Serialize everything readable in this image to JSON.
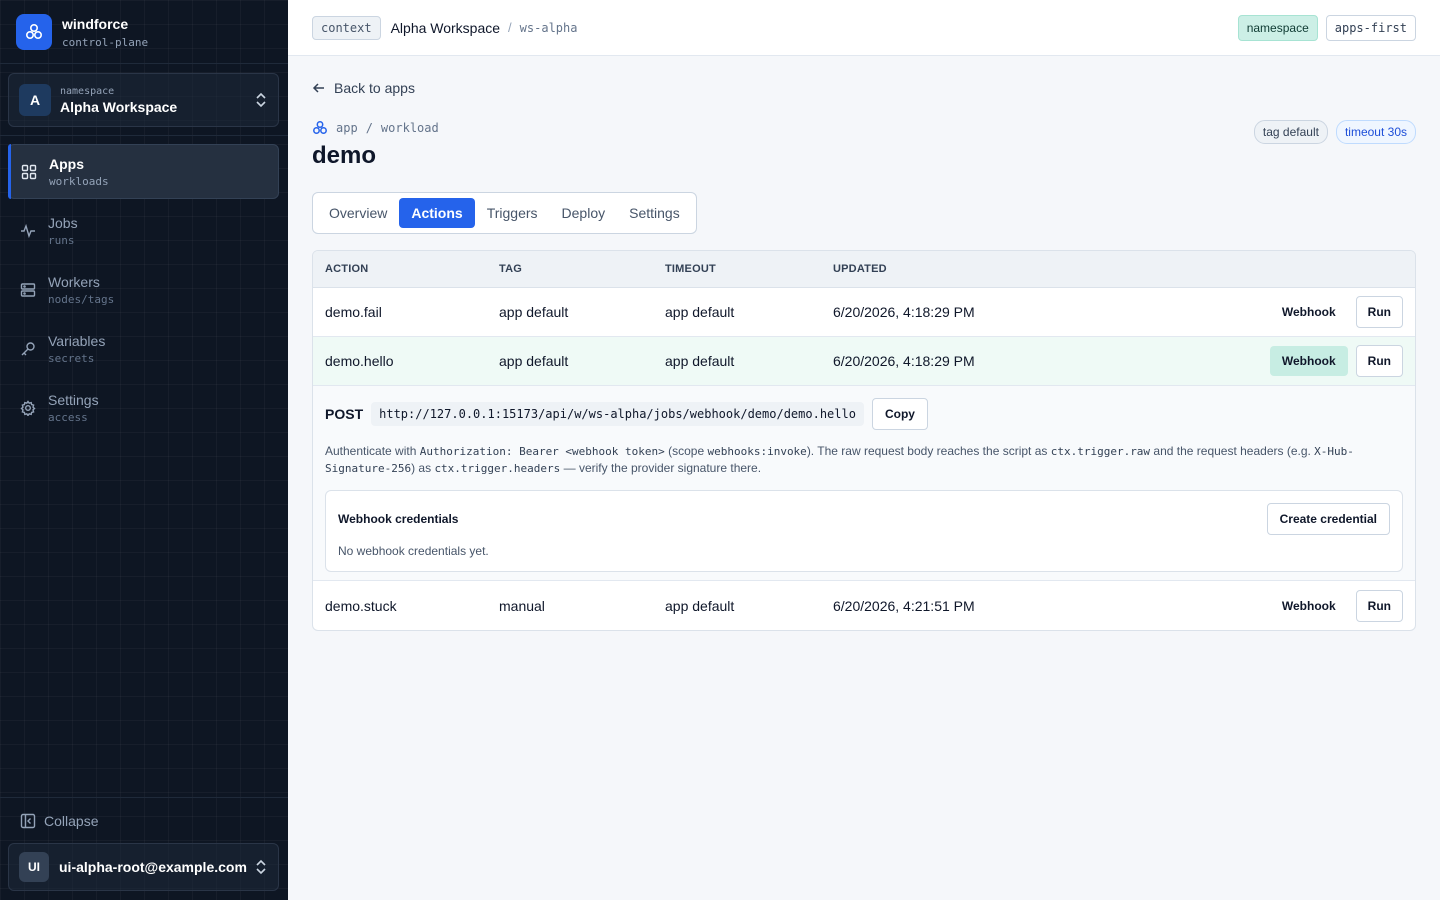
{
  "brand": {
    "name": "windforce",
    "sub": "control-plane"
  },
  "namespace": {
    "avatar": "A",
    "label": "namespace",
    "name": "Alpha Workspace"
  },
  "nav": [
    {
      "label": "Apps",
      "sub": "workloads",
      "icon": "grid-icon",
      "active": true
    },
    {
      "label": "Jobs",
      "sub": "runs",
      "icon": "activity-icon"
    },
    {
      "label": "Workers",
      "sub": "nodes/tags",
      "icon": "server-icon"
    },
    {
      "label": "Variables",
      "sub": "secrets",
      "icon": "key-icon"
    },
    {
      "label": "Settings",
      "sub": "access",
      "icon": "gear-icon"
    }
  ],
  "collapse_label": "Collapse",
  "user": {
    "avatar": "UI",
    "email": "ui-alpha-root@example.com"
  },
  "header": {
    "context_chip": "context",
    "workspace": "Alpha Workspace",
    "separator": "/",
    "workspace_id": "ws-alpha",
    "pill_namespace": "namespace",
    "pill_apps": "apps-first"
  },
  "page": {
    "back_label": "Back to apps",
    "crumb_app": "app",
    "crumb_sep": "/",
    "crumb_kind": "workload",
    "title": "demo",
    "tag_default": "tag default",
    "tag_timeout": "timeout 30s"
  },
  "tabs": [
    "Overview",
    "Actions",
    "Triggers",
    "Deploy",
    "Settings"
  ],
  "active_tab": "Actions",
  "table": {
    "headers": [
      "ACTION",
      "TAG",
      "TIMEOUT",
      "UPDATED"
    ],
    "webhook_label": "Webhook",
    "run_label": "Run",
    "rows": [
      {
        "action": "demo.fail",
        "tag": "app default",
        "timeout": "app default",
        "updated": "6/20/2026, 4:18:29 PM"
      },
      {
        "action": "demo.hello",
        "tag": "app default",
        "timeout": "app default",
        "updated": "6/20/2026, 4:18:29 PM"
      },
      {
        "action": "demo.stuck",
        "tag": "manual",
        "timeout": "app default",
        "updated": "6/20/2026, 4:21:51 PM"
      }
    ]
  },
  "webhook": {
    "method": "POST",
    "url": "http://127.0.0.1:15173/api/w/ws-alpha/jobs/webhook/demo/demo.hello",
    "copy_label": "Copy",
    "auth_p1": "Authenticate with ",
    "auth_code1": "Authorization: Bearer <webhook token>",
    "auth_p2": " (scope ",
    "auth_code2": "webhooks:invoke",
    "auth_p3": "). The raw request body reaches the script as ",
    "auth_code3": "ctx.trigger.raw",
    "auth_p4": " and the request headers (e.g. ",
    "auth_code4": "X-Hub-Signature-256",
    "auth_p5": ") as ",
    "auth_code5": "ctx.trigger.headers",
    "auth_p6": " — verify the provider signature there.",
    "credentials_title": "Webhook credentials",
    "create_label": "Create credential",
    "empty_label": "No webhook credentials yet."
  },
  "colors": {
    "accent": "#2563eb",
    "sidebar_bg": "#0e1623",
    "highlight_row": "#effaf6",
    "webhook_active": "#c7ede3"
  }
}
